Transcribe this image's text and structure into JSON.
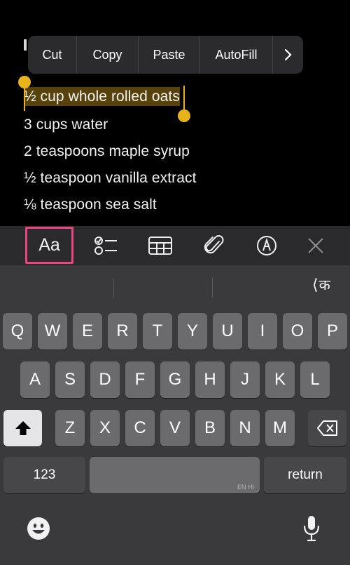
{
  "note": {
    "lines": [
      "½ cup whole rolled oats",
      "3 cups water",
      "2 teaspoons maple syrup",
      "½ teaspoon vanilla extract",
      "⅛ teaspoon sea salt"
    ]
  },
  "edit_menu": {
    "items": [
      "Cut",
      "Copy",
      "Paste",
      "AutoFill"
    ],
    "more": "›"
  },
  "toolbar": {
    "format_label": "Aa",
    "icons": [
      "checklist-icon",
      "table-icon",
      "attachment-icon",
      "markup-icon",
      "close-icon"
    ]
  },
  "keyboard": {
    "suggestion": "क",
    "row1": [
      "Q",
      "W",
      "E",
      "R",
      "T",
      "Y",
      "U",
      "I",
      "O",
      "P"
    ],
    "row2": [
      "A",
      "S",
      "D",
      "F",
      "G",
      "H",
      "J",
      "K",
      "L"
    ],
    "row3": [
      "Z",
      "X",
      "C",
      "V",
      "B",
      "N",
      "M"
    ],
    "numbers_label": "123",
    "space_tag": "EN HI",
    "return_label": "return"
  },
  "colors": {
    "selection": "#e8b21a",
    "highlight_border": "#e9467f"
  }
}
